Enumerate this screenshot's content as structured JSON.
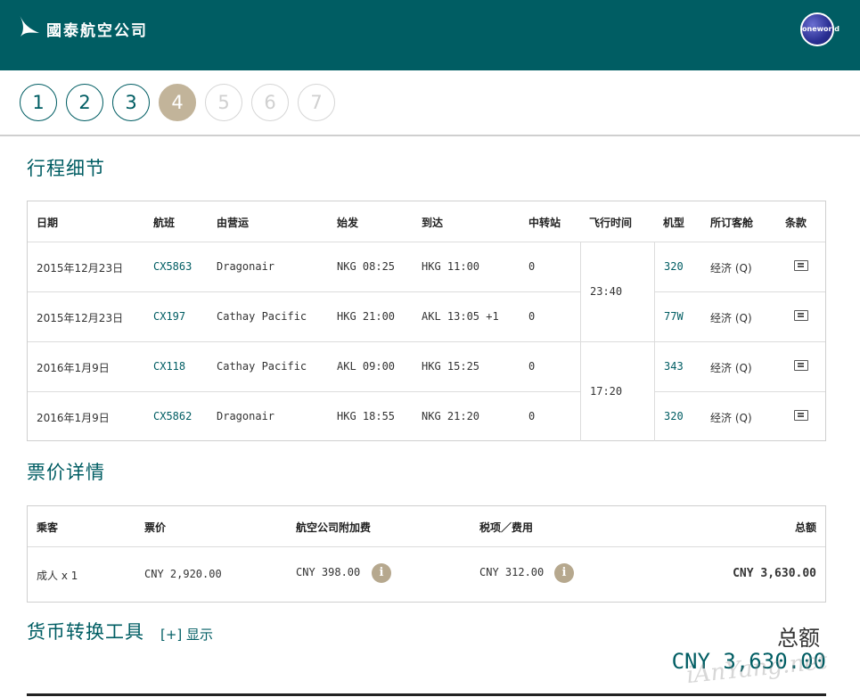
{
  "header": {
    "brand_name": "國泰航空公司",
    "oneworld_label": "oneworld"
  },
  "steps": [
    "1",
    "2",
    "3",
    "4",
    "5",
    "6",
    "7"
  ],
  "itinerary": {
    "title": "行程细节",
    "columns": [
      "日期",
      "航班",
      "由营运",
      "始发",
      "到达",
      "中转站",
      "飞行时间",
      "机型",
      "所订客舱",
      "条款"
    ],
    "rows": [
      {
        "date": "2015年12月23日",
        "flight": "CX5863",
        "operator": "Dragonair",
        "depart": "NKG 08:25",
        "arrive": "HKG 11:00",
        "stops": "0",
        "aircraft": "320",
        "cabin": "经济 (Q)"
      },
      {
        "date": "2015年12月23日",
        "flight": "CX197",
        "operator": "Cathay Pacific",
        "depart": "HKG 21:00",
        "arrive": "AKL 13:05 +1",
        "stops": "0",
        "aircraft": "77W",
        "cabin": "经济 (Q)"
      },
      {
        "date": "2016年1月9日",
        "flight": "CX118",
        "operator": "Cathay Pacific",
        "depart": "AKL 09:00",
        "arrive": "HKG 15:25",
        "stops": "0",
        "aircraft": "343",
        "cabin": "经济 (Q)"
      },
      {
        "date": "2016年1月9日",
        "flight": "CX5862",
        "operator": "Dragonair",
        "depart": "HKG 18:55",
        "arrive": "NKG 21:20",
        "stops": "0",
        "aircraft": "320",
        "cabin": "经济 (Q)"
      }
    ],
    "durations": [
      "23:40",
      "17:20"
    ],
    "terms_icon": "document-icon"
  },
  "fare": {
    "title": "票价详情",
    "columns": [
      "乘客",
      "票价",
      "航空公司附加费",
      "税项／费用",
      "总额"
    ],
    "row": {
      "passenger": "成人 x 1",
      "fare": "CNY 2,920.00",
      "surcharge": "CNY 398.00",
      "taxes": "CNY 312.00",
      "total": "CNY 3,630.00"
    },
    "info_icon": "i"
  },
  "converter": {
    "title": "货币转换工具",
    "toggle": "[+] 显示"
  },
  "summary": {
    "total_label": "总额",
    "total_value": "CNY 3,630.00"
  },
  "watermark": "iAnYang.net",
  "colors": {
    "brand": "#005d63",
    "accent": "#c2b49a"
  }
}
